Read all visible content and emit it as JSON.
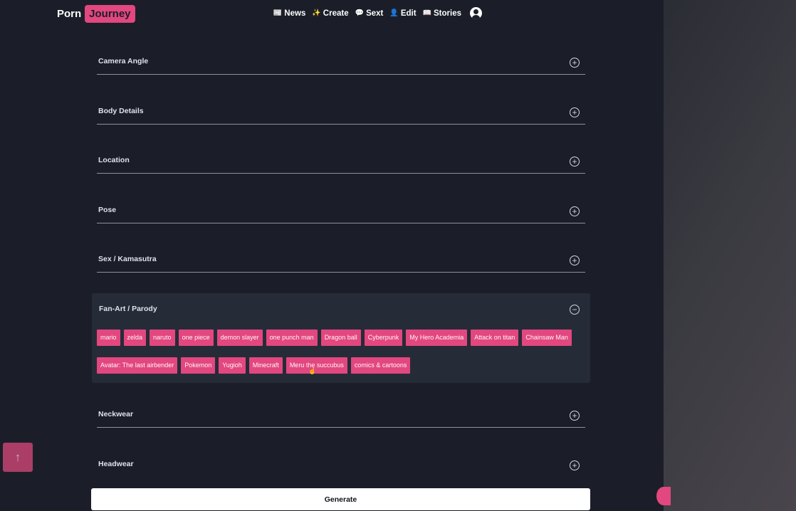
{
  "brand": {
    "part1": "Porn",
    "part2": "Journey"
  },
  "nav": {
    "items": [
      {
        "icon": "news-icon",
        "label": "News",
        "glyph": "📰"
      },
      {
        "icon": "sparkle-icon",
        "label": "Create",
        "glyph": "✨"
      },
      {
        "icon": "chat-icon",
        "label": "Sext",
        "glyph": "💬"
      },
      {
        "icon": "person-icon",
        "label": "Edit",
        "glyph": "👤"
      },
      {
        "icon": "book-icon",
        "label": "Stories",
        "glyph": "📖"
      }
    ]
  },
  "sections_above": [
    {
      "title": "Camera Angle"
    },
    {
      "title": "Body Details"
    },
    {
      "title": "Location"
    },
    {
      "title": "Pose"
    },
    {
      "title": "Sex / Kamasutra"
    }
  ],
  "open_section": {
    "title": "Fan-Art / Parody",
    "tags": [
      "mario",
      "zelda",
      "naruto",
      "one piece",
      "demon slayer",
      "one punch man",
      "Dragon ball",
      "Cyberpunk",
      "My Hero Academia",
      "Attack on titan",
      "Chainsaw Man",
      "Avatar: The last airbender",
      "Pokemon",
      "Yugioh",
      "Minecraft",
      "Meru the succubus",
      "comics & cartoons"
    ]
  },
  "sections_below": [
    {
      "title": "Neckwear"
    },
    {
      "title": "Headwear"
    }
  ],
  "icons": {
    "plus": "+",
    "minus": "−",
    "arrow_up": "↑",
    "cursor": "☝"
  },
  "generate": {
    "label": "Generate"
  },
  "colors": {
    "accent": "#e2477f",
    "background": "#1b1e29",
    "panel": "#262b38"
  }
}
